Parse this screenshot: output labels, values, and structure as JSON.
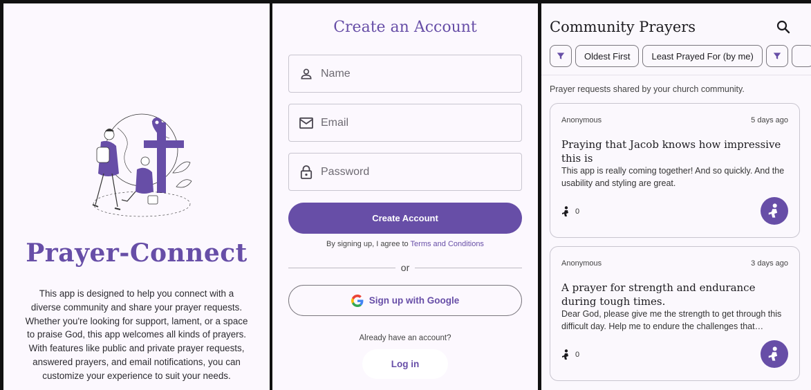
{
  "welcome": {
    "brand": "Prayer-Connect",
    "description": "This app is designed to help you connect with a diverse community and share your prayer requests. Whether you're looking for support, lament, or a space to praise God, this app welcomes all kinds of prayers. With features like public and private prayer requests, answered prayers, and email notifications, you can customize your experience to suit your needs."
  },
  "signup": {
    "title": "Create an Account",
    "name_placeholder": "Name",
    "email_placeholder": "Email",
    "password_placeholder": "Password",
    "create_button": "Create Account",
    "terms_prefix": "By signing up, I agree to ",
    "terms_link": "Terms and Conditions",
    "or": "or",
    "google_button": "Sign up with Google",
    "have_account": "Already have an account?",
    "login_button": "Log in"
  },
  "community": {
    "title": "Community Prayers",
    "chips": [
      "Oldest First",
      "Least Prayed For (by me)"
    ],
    "subtitle": "Prayer requests shared by your church community.",
    "prayers": [
      {
        "author": "Anonymous",
        "when": "5 days ago",
        "title": "Praying that Jacob knows how impressive this is",
        "body": "This app is really coming together! And so quickly. And the usability and styling are great.",
        "count": "0"
      },
      {
        "author": "Anonymous",
        "when": "3 days ago",
        "title": "A prayer for strength and endurance during tough times.",
        "body": "Dear God, please give me the strength to get through this difficult day. Help me to endure the challenges that…",
        "count": "0"
      }
    ]
  },
  "colors": {
    "accent": "#674ea7",
    "background": "#fcf8fe"
  },
  "icons": [
    "person-icon",
    "mail-icon",
    "lock-icon",
    "google-icon",
    "search-icon",
    "filter-icon",
    "praying-icon"
  ]
}
